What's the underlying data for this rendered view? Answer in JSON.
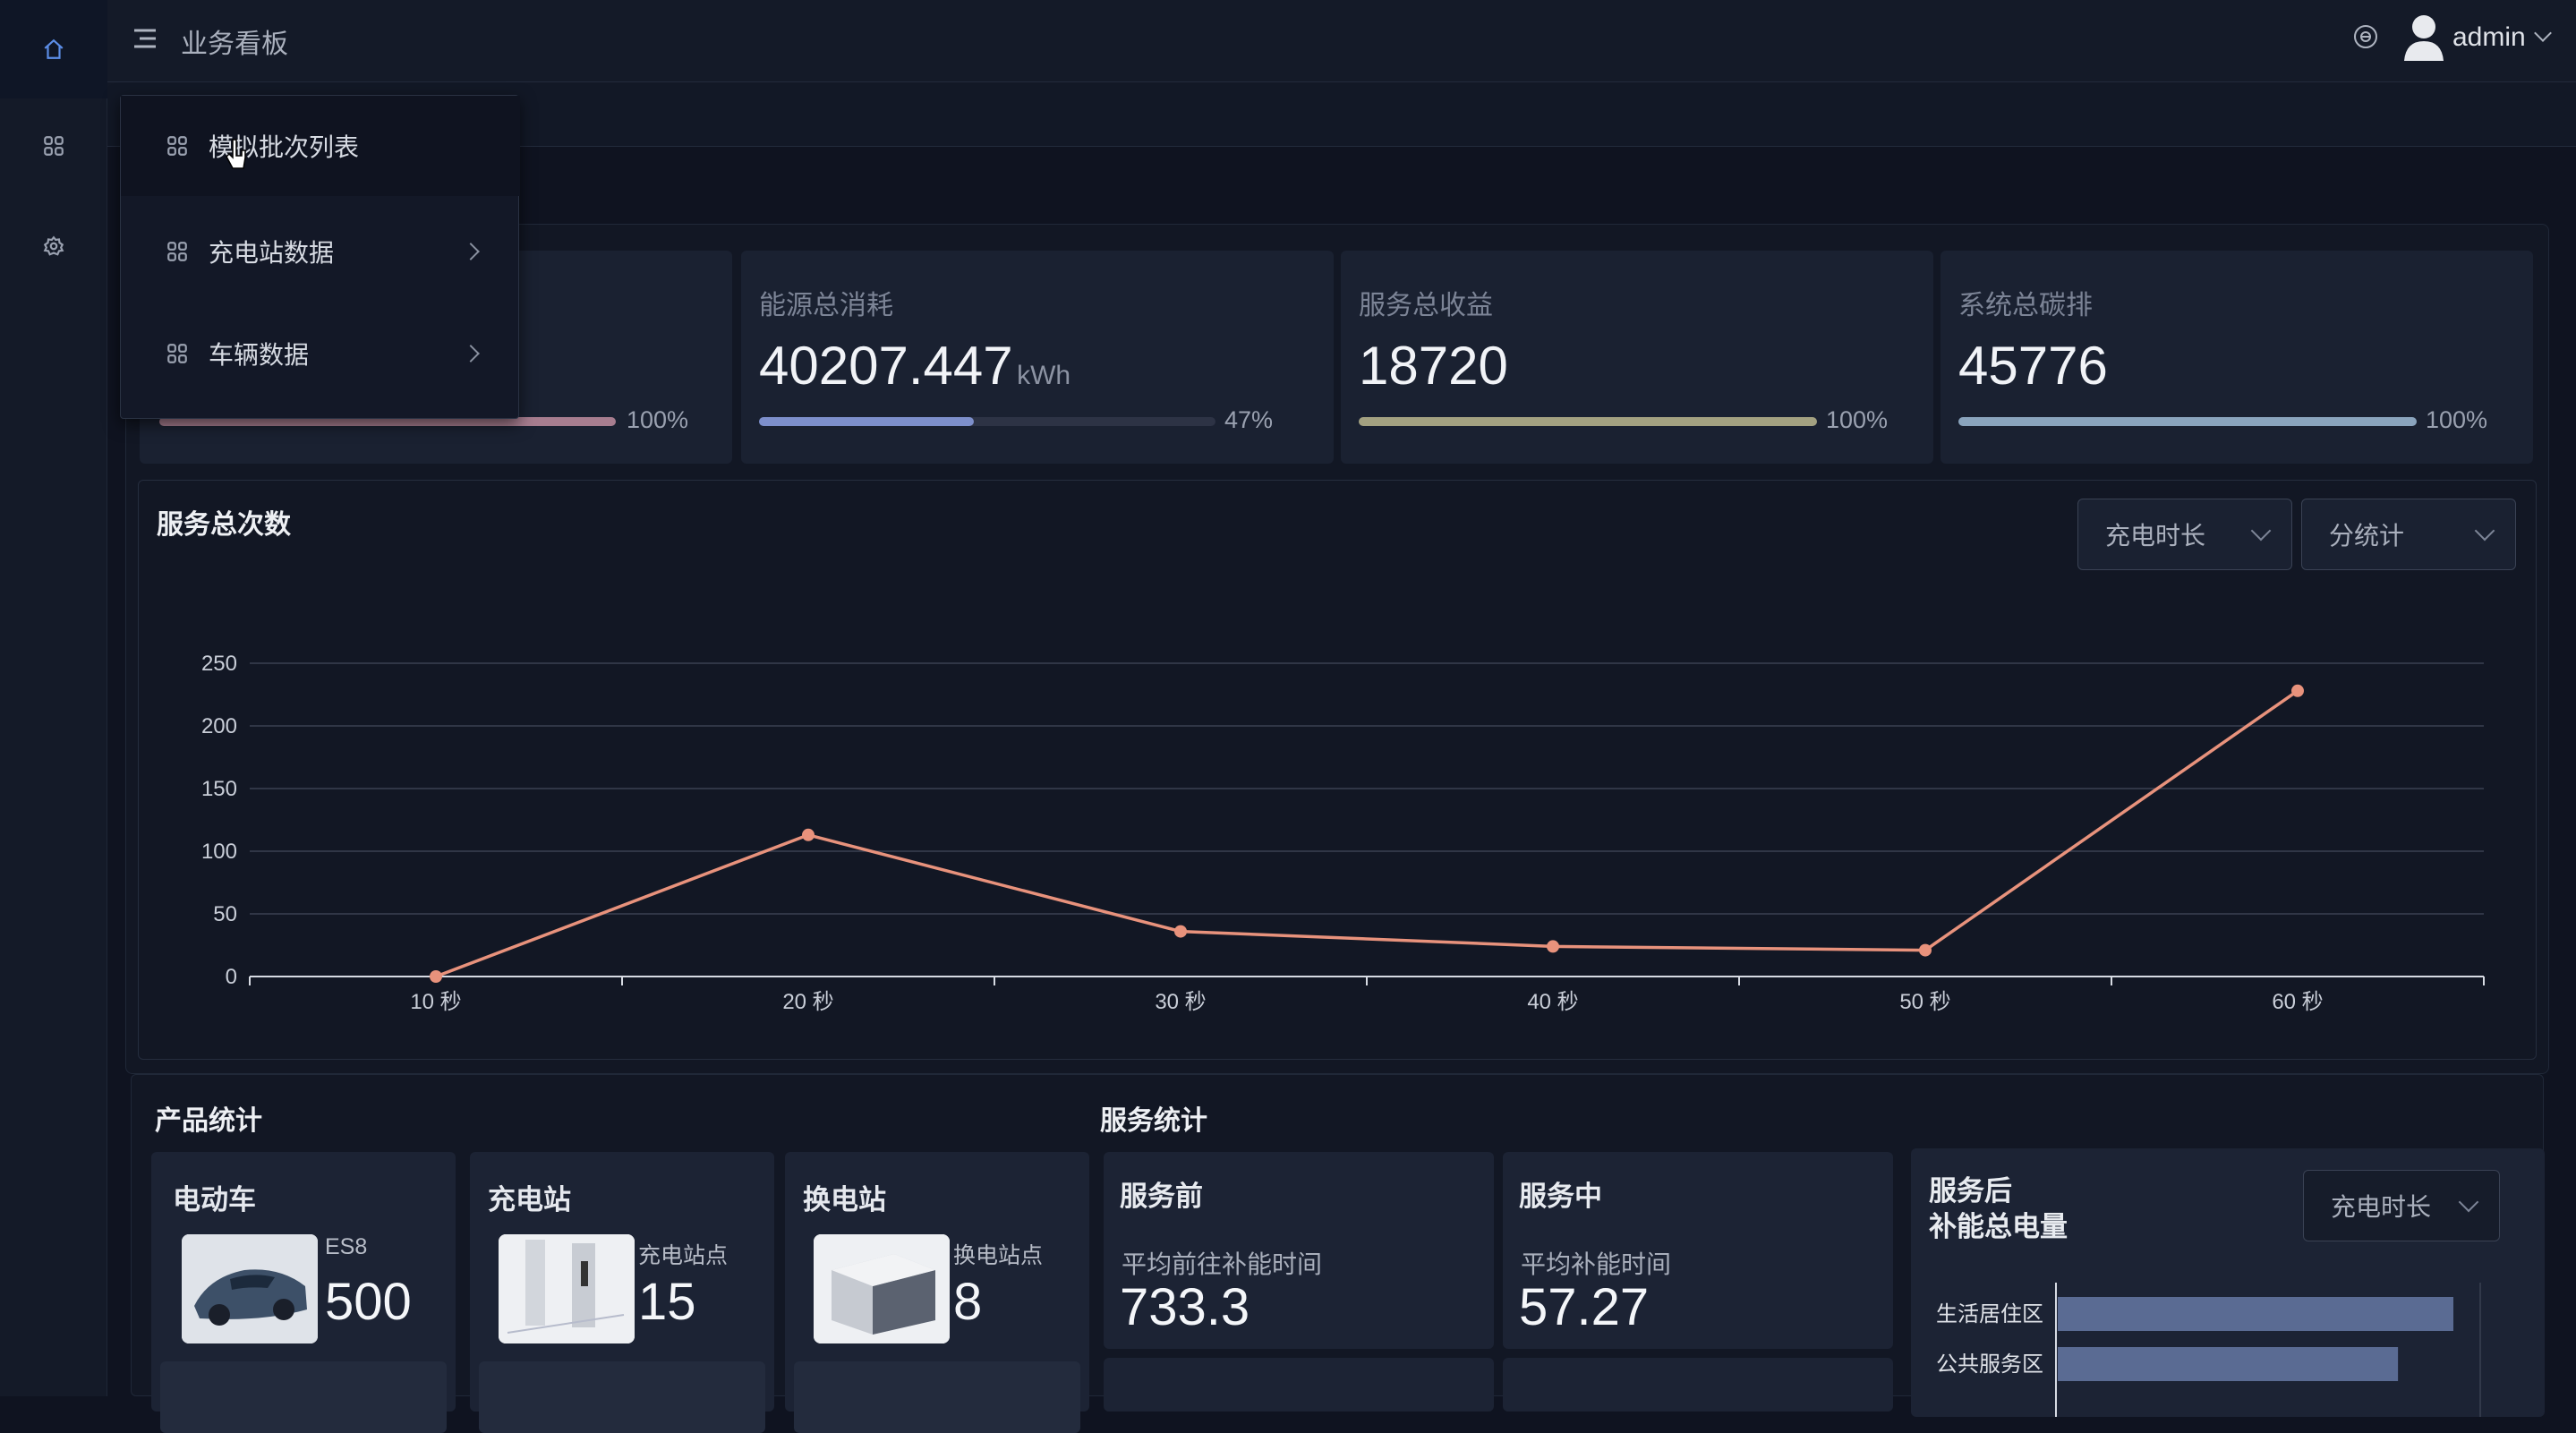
{
  "header": {
    "title": "业务看板",
    "user": "admin"
  },
  "menu": {
    "items": [
      {
        "label": "模拟批次列表",
        "has_arrow": false
      },
      {
        "label": "充电站数据",
        "has_arrow": true
      },
      {
        "label": "车辆数据",
        "has_arrow": true
      }
    ]
  },
  "stats": [
    {
      "title": "",
      "value": "",
      "unit": "",
      "percent_label": "100%",
      "percent": 100,
      "color": "#a77d8f"
    },
    {
      "title": "能源总消耗",
      "value": "40207.447",
      "unit": "kWh",
      "percent_label": "47%",
      "percent": 47,
      "color": "#7d8fcb"
    },
    {
      "title": "服务总收益",
      "value": "18720",
      "unit": "",
      "percent_label": "100%",
      "percent": 100,
      "color": "#a3a181"
    },
    {
      "title": "系统总碳排",
      "value": "45776",
      "unit": "",
      "percent_label": "100%",
      "percent": 100,
      "color": "#8aa4bd"
    }
  ],
  "chart_section": {
    "title": "服务总次数",
    "dropdown1": "充电时长",
    "dropdown2": "分统计"
  },
  "chart_data": {
    "type": "line",
    "categories": [
      "10 秒",
      "20 秒",
      "30 秒",
      "40 秒",
      "50 秒",
      "60 秒"
    ],
    "series": [
      {
        "values": [
          0,
          113,
          36,
          24,
          21,
          228
        ],
        "color": "#e8927c"
      }
    ],
    "ylim": [
      0,
      250
    ],
    "yticks": [
      0,
      50,
      100,
      150,
      200,
      250
    ],
    "grid": true
  },
  "product_stats": {
    "title": "产品统计",
    "cards": [
      {
        "title": "电动车",
        "label": "ES8",
        "value": "500"
      },
      {
        "title": "充电站",
        "label": "充电站点",
        "value": "15"
      },
      {
        "title": "换电站",
        "label": "换电站点",
        "value": "8"
      }
    ]
  },
  "service_stats": {
    "title": "服务统计",
    "before": {
      "title": "服务前",
      "label": "平均前往补能时间",
      "value": "733.3"
    },
    "during": {
      "title": "服务中",
      "label": "平均补能时间",
      "value": "57.27"
    },
    "after": {
      "title": "服务后",
      "subtitle": "补能总电量",
      "dropdown": "充电时长",
      "bars": [
        {
          "label": "生活居住区",
          "value": 100
        },
        {
          "label": "公共服务区",
          "value": 86
        }
      ]
    }
  }
}
